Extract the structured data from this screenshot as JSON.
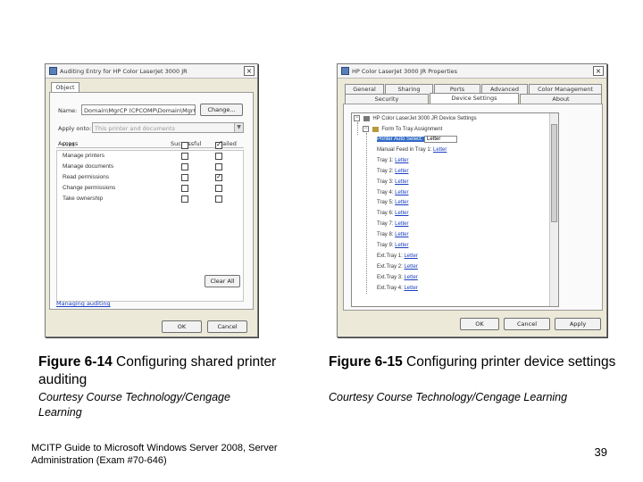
{
  "audit_dialog": {
    "title": "Auditing Entry for HP Color LaserJet 3000 JR",
    "tab": "Object",
    "name_label": "Name:",
    "name_value": "Domain\\MgrCP (CPCOMP\\Domain\\MgrCP)",
    "change_button": "Change...",
    "apply_onto_label": "Apply onto:",
    "apply_onto_value": "This printer and documents",
    "col_access": "Access",
    "col_successful": "Successful",
    "col_failed": "Failed",
    "entries": [
      {
        "label": "Print",
        "successful": false,
        "failed": true
      },
      {
        "label": "Manage printers",
        "successful": false,
        "failed": false
      },
      {
        "label": "Manage documents",
        "successful": false,
        "failed": false
      },
      {
        "label": "Read permissions",
        "successful": false,
        "failed": true
      },
      {
        "label": "Change permissions",
        "successful": false,
        "failed": false
      },
      {
        "label": "Take ownership",
        "successful": false,
        "failed": false
      }
    ],
    "clear_all_button": "Clear All",
    "link": "Managing auditing",
    "ok_button": "OK",
    "cancel_button": "Cancel"
  },
  "props_dialog": {
    "title": "HP Color LaserJet 3000 JR Properties",
    "tabs_row1": [
      "General",
      "Sharing",
      "Ports",
      "Advanced",
      "Color Management"
    ],
    "tabs_row2": [
      "Security",
      "Device Settings",
      "About"
    ],
    "tree_root": "HP Color LaserJet 3000 JR Device Settings",
    "tree_group": "Form To Tray Assignment",
    "tree_items": [
      {
        "key": "Printer Auto Select:",
        "value": "Letter"
      },
      {
        "key": "Manual Feed in Tray 1:",
        "value": "Letter"
      },
      {
        "key": "Tray 1:",
        "value": "Letter"
      },
      {
        "key": "Tray 2:",
        "value": "Letter"
      },
      {
        "key": "Tray 3:",
        "value": "Letter"
      },
      {
        "key": "Tray 4:",
        "value": "Letter"
      },
      {
        "key": "Tray 5:",
        "value": "Letter"
      },
      {
        "key": "Tray 6:",
        "value": "Letter"
      },
      {
        "key": "Tray 7:",
        "value": "Letter"
      },
      {
        "key": "Tray 8:",
        "value": "Letter"
      },
      {
        "key": "Tray 9:",
        "value": "Letter"
      },
      {
        "key": "Ext.Tray 1:",
        "value": "Letter"
      },
      {
        "key": "Ext.Tray 2:",
        "value": "Letter"
      },
      {
        "key": "Ext.Tray 3:",
        "value": "Letter"
      },
      {
        "key": "Ext.Tray 4:",
        "value": "Letter"
      }
    ],
    "ok_button": "OK",
    "cancel_button": "Cancel",
    "apply_button": "Apply"
  },
  "captions": {
    "fig1_label": "Figure 6-14",
    "fig1_text": " Configuring shared printer auditing",
    "fig1_credit": "Courtesy Course Technology/Cengage Learning",
    "fig2_label": "Figure 6-15",
    "fig2_text": " Configuring printer device settings",
    "fig2_credit": "Courtesy Course Technology/Cengage Learning"
  },
  "footer": {
    "book": "MCITP Guide to Microsoft Windows Server 2008, Server Administration (Exam #70-646)",
    "page": "39"
  }
}
